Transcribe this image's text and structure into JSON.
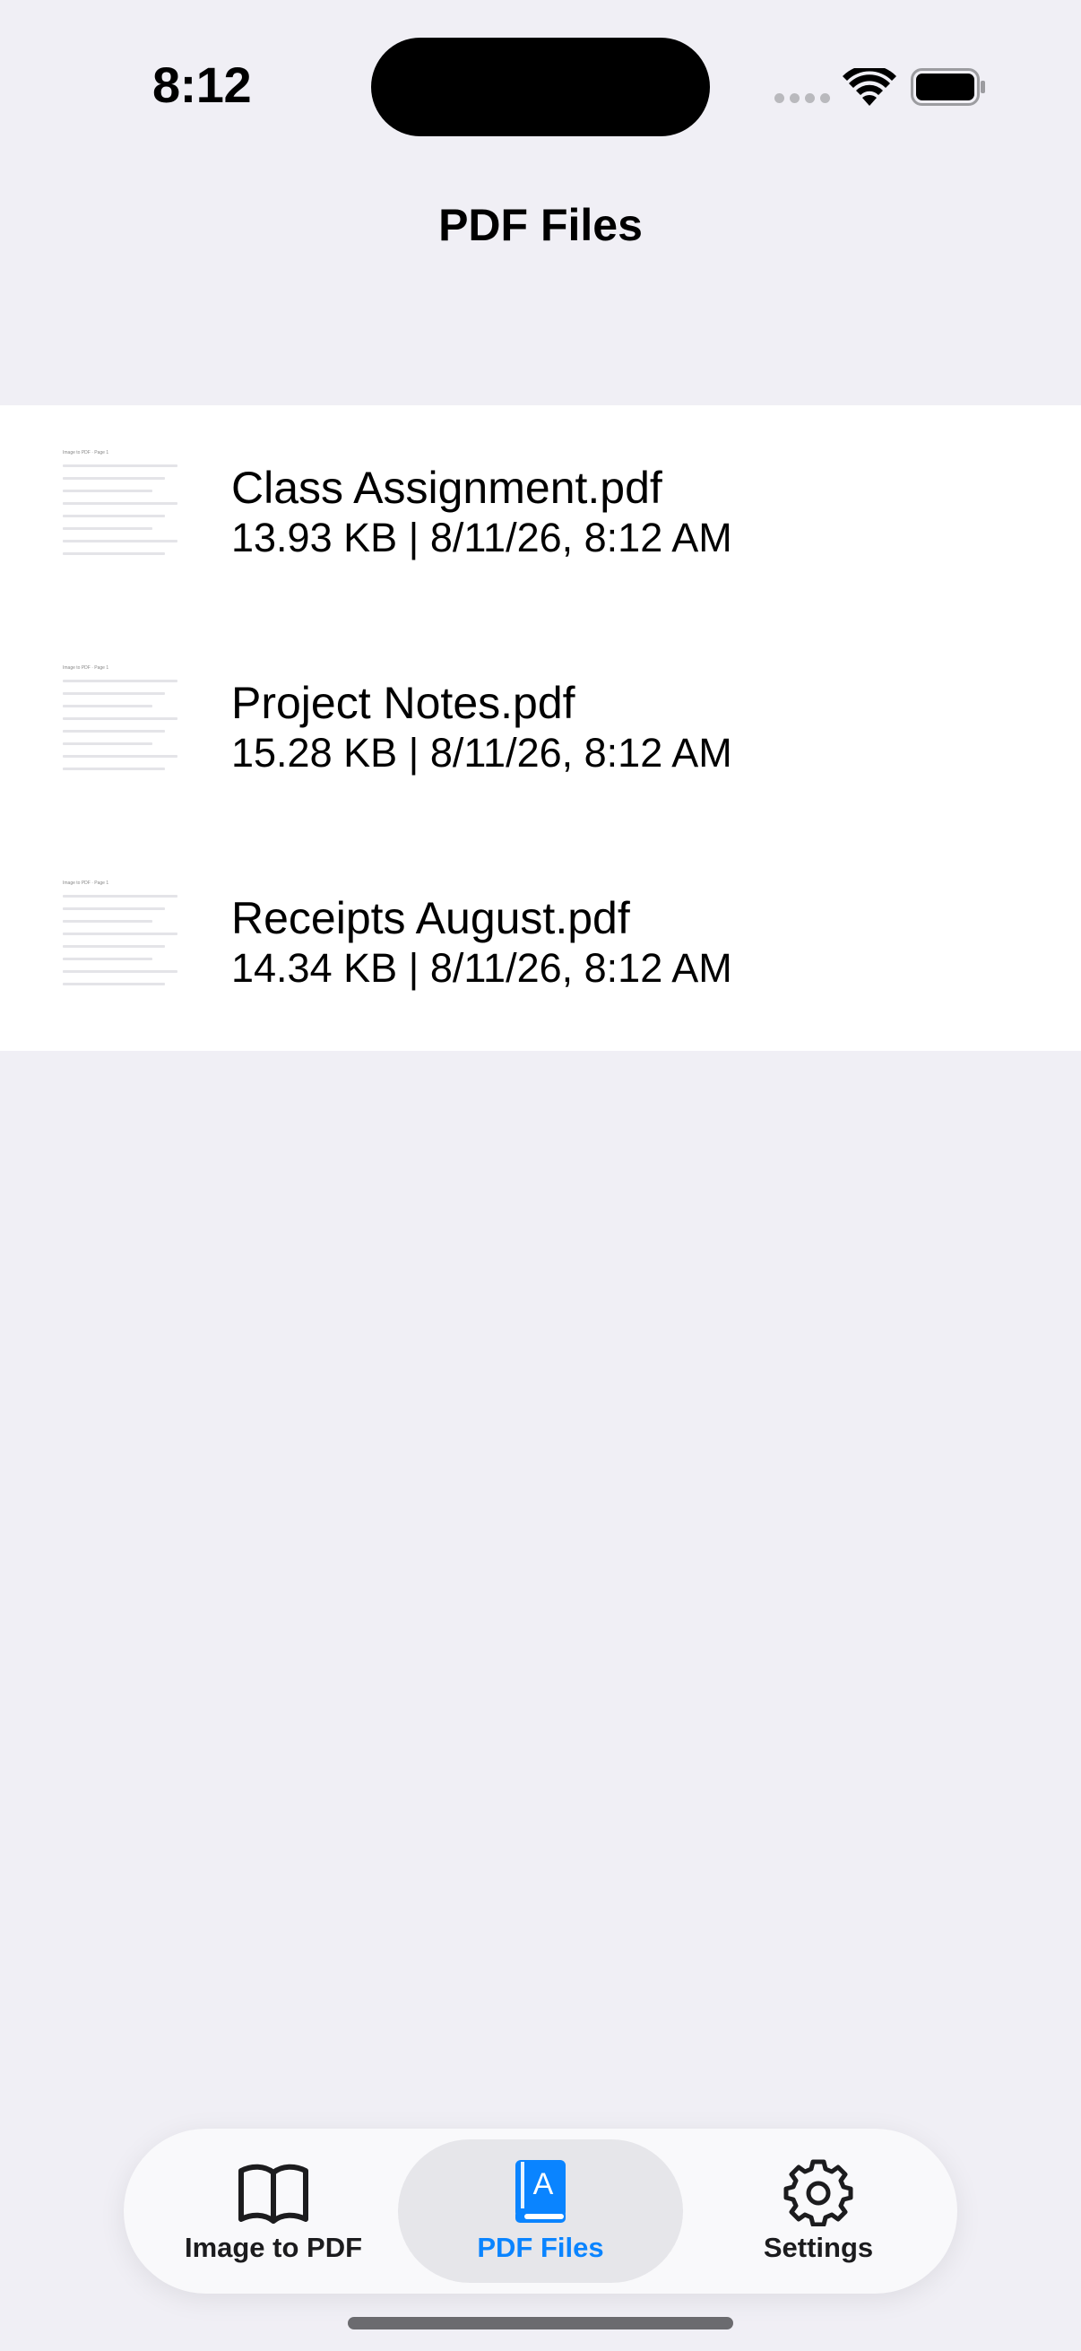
{
  "status_bar": {
    "time": "8:12"
  },
  "header": {
    "title": "PDF Files"
  },
  "files": [
    {
      "name": "Class Assignment.pdf",
      "meta": "13.93 KB | 8/11/26, 8:12 AM",
      "thumb_label": "Image to PDF · Page 1"
    },
    {
      "name": "Project Notes.pdf",
      "meta": "15.28 KB | 8/11/26, 8:12 AM",
      "thumb_label": "Image to PDF · Page 1"
    },
    {
      "name": "Receipts August.pdf",
      "meta": "14.34 KB | 8/11/26, 8:12 AM",
      "thumb_label": "Image to PDF · Page 1"
    }
  ],
  "tab_bar": {
    "tabs": [
      {
        "label": "Image to PDF",
        "icon": "book-open-icon",
        "active": false
      },
      {
        "label": "PDF Files",
        "icon": "book-letter-a-icon",
        "active": true
      },
      {
        "label": "Settings",
        "icon": "gear-icon",
        "active": false
      }
    ]
  },
  "colors": {
    "accent": "#0a84ff",
    "background": "#f0eff5",
    "list_background": "#ffffff"
  }
}
